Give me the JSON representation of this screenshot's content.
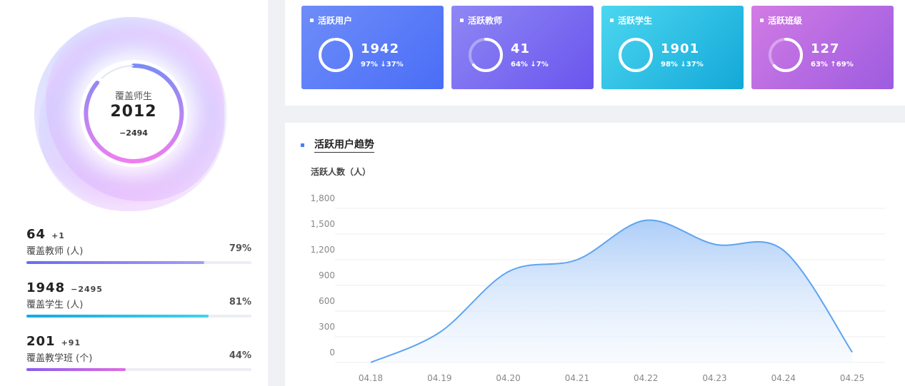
{
  "coverage": {
    "label": "覆盖师生",
    "value": "2012",
    "delta": "−2494"
  },
  "stats": [
    {
      "num": "64",
      "delta": "+1",
      "label": "覆盖教师 (人)",
      "pct_text": "79%",
      "progress": 0.79,
      "color_from": "#6b6cf3",
      "color_to": "#a49cf7"
    },
    {
      "num": "1948",
      "delta": "−2495",
      "label": "覆盖学生 (人)",
      "pct_text": "81%",
      "progress": 0.81,
      "color_from": "#12a9e6",
      "color_to": "#3fd4ea"
    },
    {
      "num": "201",
      "delta": "+91",
      "label": "覆盖教学班 (个)",
      "pct_text": "44%",
      "progress": 0.44,
      "color_from": "#8a5cf0",
      "color_to": "#e06ce0"
    }
  ],
  "kpi_cards": [
    {
      "title": "活跃用户",
      "value": "1942",
      "sub": "97% ↓37%",
      "progress": 0.97,
      "color_from": "#6e8df8",
      "color_to": "#4a6df7"
    },
    {
      "title": "活跃教师",
      "value": "41",
      "sub": "64% ↓7%",
      "progress": 0.64,
      "color_from": "#8f87f4",
      "color_to": "#6a55ee"
    },
    {
      "title": "活跃学生",
      "value": "1901",
      "sub": "98% ↓37%",
      "progress": 0.98,
      "color_from": "#4cd7f0",
      "color_to": "#13a8d8"
    },
    {
      "title": "活跃班级",
      "value": "127",
      "sub": "63% ↑69%",
      "progress": 0.63,
      "color_from": "#d27be4",
      "color_to": "#9d5ce0"
    }
  ],
  "chart": {
    "title": "活跃用户趋势",
    "ylabel": "活跃人数（人）"
  },
  "chart_data": {
    "type": "area",
    "title": "活跃用户趋势",
    "ylabel": "活跃人数（人）",
    "categories": [
      "04.18",
      "04.19",
      "04.20",
      "04.21",
      "04.22",
      "04.23",
      "04.24",
      "04.25"
    ],
    "y_ticks": [
      "0",
      "300",
      "600",
      "900",
      "1,200",
      "1,500",
      "1,800"
    ],
    "ylim": [
      0,
      1800
    ],
    "values": [
      0,
      350,
      1060,
      1200,
      1660,
      1380,
      1310,
      120
    ],
    "line_color": "#5ea4f0",
    "grid": true
  }
}
